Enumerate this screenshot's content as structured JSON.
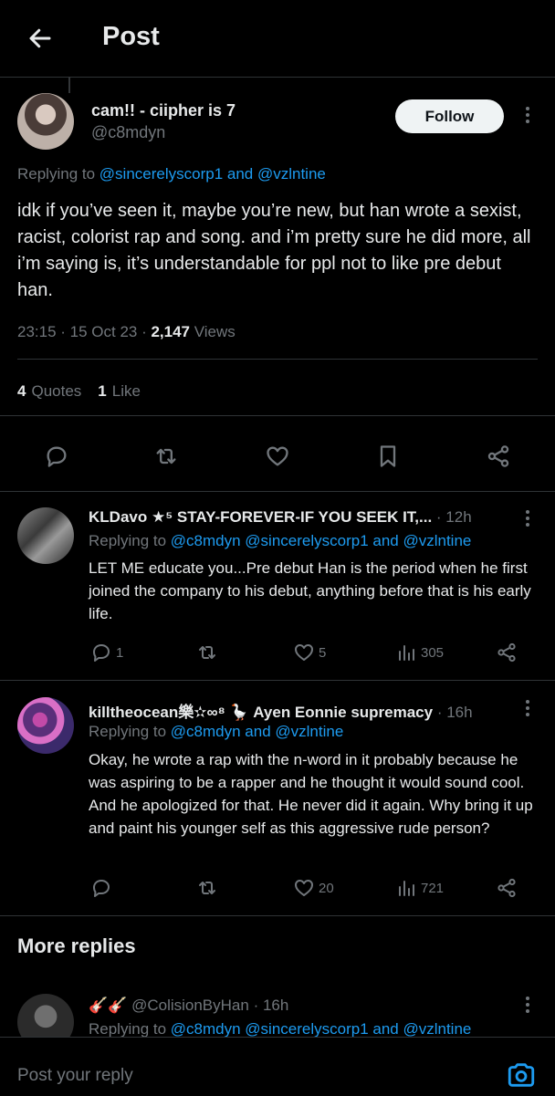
{
  "header": {
    "title": "Post",
    "back_icon": "arrow-left-icon"
  },
  "main_post": {
    "name": "cam!! - ciipher is 7",
    "handle": "@c8mdyn",
    "follow_label": "Follow",
    "replying_prefix": "Replying to ",
    "replying_mention_1": "@sincerelyscorp1",
    "replying_and": " and ",
    "replying_mention_2": "@vzlntine",
    "text": "idk if you’ve seen it, maybe you’re new, but han wrote a sexist, racist, colorist rap and song. and i’m pretty sure he did more, all i’m saying is, it’s understandable for ppl not to like pre debut han.",
    "time": "23:15 · 15 Oct 23 · ",
    "views_count": "2,147",
    "views_label": " Views",
    "quotes_count": "4",
    "quotes_label": "Quotes",
    "likes_count": "1",
    "likes_label": "Like"
  },
  "replies": [
    {
      "name": "KLDavo ★⁵ STAY-FOREVER-IF YOU SEEK IT,...",
      "time": " · 12h",
      "replying_prefix": "Replying to ",
      "mentions": "@c8mdyn @sincerelyscorp1",
      "replying_and": " and ",
      "mention_last": "@vzlntine",
      "text": "LET ME educate you...Pre debut Han is the period when he first joined the company to his debut, anything before that is his early life.",
      "reply_count": "1",
      "retweet_count": "",
      "like_count": "5",
      "view_count": "305"
    },
    {
      "name": "killtheocean樂✫∞⁸ 🪿 Ayen Eonnie supremacy",
      "time": " · 16h",
      "replying_prefix": "Replying to ",
      "mentions": "@c8mdyn",
      "replying_and": " and ",
      "mention_last": "@vzlntine",
      "text": "Okay, he wrote a rap with the n-word in it probably because he was aspiring to be a rapper and he thought it would sound cool. And he apologized for that. He never did it again. Why bring it up and paint his younger self as this aggressive rude person?",
      "reply_count": "",
      "retweet_count": "",
      "like_count": "20",
      "view_count": "721"
    }
  ],
  "more_replies": {
    "heading": "More replies",
    "items": [
      {
        "name": "🎸🎸",
        "handle": "@ColisionByHan",
        "time": " · 16h",
        "replying_prefix": "Replying to ",
        "mentions": "@c8mdyn @sincerelyscorp1",
        "replying_and": " and ",
        "mention_last": "@vzlntine"
      }
    ]
  },
  "composer": {
    "placeholder": "Post your reply",
    "camera_icon": "camera-icon"
  },
  "colors": {
    "accent": "#1d9bf0",
    "muted": "#71767b",
    "text": "#e7e9ea",
    "background": "#000000"
  }
}
